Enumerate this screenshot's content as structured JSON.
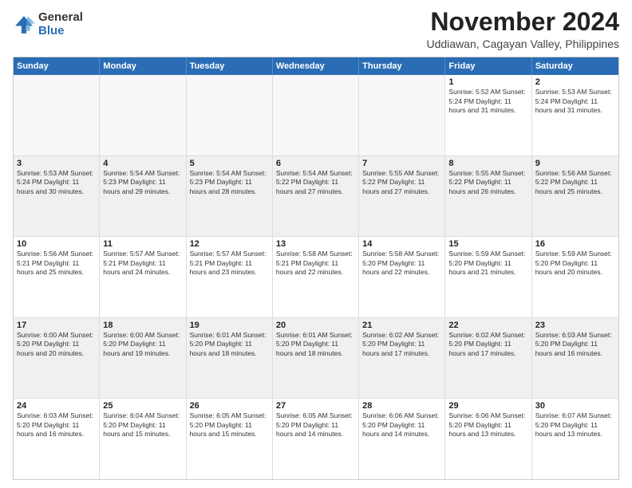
{
  "logo": {
    "general": "General",
    "blue": "Blue"
  },
  "title": "November 2024",
  "location": "Uddiawan, Cagayan Valley, Philippines",
  "days_of_week": [
    "Sunday",
    "Monday",
    "Tuesday",
    "Wednesday",
    "Thursday",
    "Friday",
    "Saturday"
  ],
  "weeks": [
    [
      {
        "day": "",
        "info": ""
      },
      {
        "day": "",
        "info": ""
      },
      {
        "day": "",
        "info": ""
      },
      {
        "day": "",
        "info": ""
      },
      {
        "day": "",
        "info": ""
      },
      {
        "day": "1",
        "info": "Sunrise: 5:52 AM\nSunset: 5:24 PM\nDaylight: 11 hours\nand 31 minutes."
      },
      {
        "day": "2",
        "info": "Sunrise: 5:53 AM\nSunset: 5:24 PM\nDaylight: 11 hours\nand 31 minutes."
      }
    ],
    [
      {
        "day": "3",
        "info": "Sunrise: 5:53 AM\nSunset: 5:24 PM\nDaylight: 11 hours\nand 30 minutes."
      },
      {
        "day": "4",
        "info": "Sunrise: 5:54 AM\nSunset: 5:23 PM\nDaylight: 11 hours\nand 29 minutes."
      },
      {
        "day": "5",
        "info": "Sunrise: 5:54 AM\nSunset: 5:23 PM\nDaylight: 11 hours\nand 28 minutes."
      },
      {
        "day": "6",
        "info": "Sunrise: 5:54 AM\nSunset: 5:22 PM\nDaylight: 11 hours\nand 27 minutes."
      },
      {
        "day": "7",
        "info": "Sunrise: 5:55 AM\nSunset: 5:22 PM\nDaylight: 11 hours\nand 27 minutes."
      },
      {
        "day": "8",
        "info": "Sunrise: 5:55 AM\nSunset: 5:22 PM\nDaylight: 11 hours\nand 26 minutes."
      },
      {
        "day": "9",
        "info": "Sunrise: 5:56 AM\nSunset: 5:22 PM\nDaylight: 11 hours\nand 25 minutes."
      }
    ],
    [
      {
        "day": "10",
        "info": "Sunrise: 5:56 AM\nSunset: 5:21 PM\nDaylight: 11 hours\nand 25 minutes."
      },
      {
        "day": "11",
        "info": "Sunrise: 5:57 AM\nSunset: 5:21 PM\nDaylight: 11 hours\nand 24 minutes."
      },
      {
        "day": "12",
        "info": "Sunrise: 5:57 AM\nSunset: 5:21 PM\nDaylight: 11 hours\nand 23 minutes."
      },
      {
        "day": "13",
        "info": "Sunrise: 5:58 AM\nSunset: 5:21 PM\nDaylight: 11 hours\nand 22 minutes."
      },
      {
        "day": "14",
        "info": "Sunrise: 5:58 AM\nSunset: 5:20 PM\nDaylight: 11 hours\nand 22 minutes."
      },
      {
        "day": "15",
        "info": "Sunrise: 5:59 AM\nSunset: 5:20 PM\nDaylight: 11 hours\nand 21 minutes."
      },
      {
        "day": "16",
        "info": "Sunrise: 5:59 AM\nSunset: 5:20 PM\nDaylight: 11 hours\nand 20 minutes."
      }
    ],
    [
      {
        "day": "17",
        "info": "Sunrise: 6:00 AM\nSunset: 5:20 PM\nDaylight: 11 hours\nand 20 minutes."
      },
      {
        "day": "18",
        "info": "Sunrise: 6:00 AM\nSunset: 5:20 PM\nDaylight: 11 hours\nand 19 minutes."
      },
      {
        "day": "19",
        "info": "Sunrise: 6:01 AM\nSunset: 5:20 PM\nDaylight: 11 hours\nand 18 minutes."
      },
      {
        "day": "20",
        "info": "Sunrise: 6:01 AM\nSunset: 5:20 PM\nDaylight: 11 hours\nand 18 minutes."
      },
      {
        "day": "21",
        "info": "Sunrise: 6:02 AM\nSunset: 5:20 PM\nDaylight: 11 hours\nand 17 minutes."
      },
      {
        "day": "22",
        "info": "Sunrise: 6:02 AM\nSunset: 5:20 PM\nDaylight: 11 hours\nand 17 minutes."
      },
      {
        "day": "23",
        "info": "Sunrise: 6:03 AM\nSunset: 5:20 PM\nDaylight: 11 hours\nand 16 minutes."
      }
    ],
    [
      {
        "day": "24",
        "info": "Sunrise: 6:03 AM\nSunset: 5:20 PM\nDaylight: 11 hours\nand 16 minutes."
      },
      {
        "day": "25",
        "info": "Sunrise: 6:04 AM\nSunset: 5:20 PM\nDaylight: 11 hours\nand 15 minutes."
      },
      {
        "day": "26",
        "info": "Sunrise: 6:05 AM\nSunset: 5:20 PM\nDaylight: 11 hours\nand 15 minutes."
      },
      {
        "day": "27",
        "info": "Sunrise: 6:05 AM\nSunset: 5:20 PM\nDaylight: 11 hours\nand 14 minutes."
      },
      {
        "day": "28",
        "info": "Sunrise: 6:06 AM\nSunset: 5:20 PM\nDaylight: 11 hours\nand 14 minutes."
      },
      {
        "day": "29",
        "info": "Sunrise: 6:06 AM\nSunset: 5:20 PM\nDaylight: 11 hours\nand 13 minutes."
      },
      {
        "day": "30",
        "info": "Sunrise: 6:07 AM\nSunset: 5:20 PM\nDaylight: 11 hours\nand 13 minutes."
      }
    ]
  ]
}
